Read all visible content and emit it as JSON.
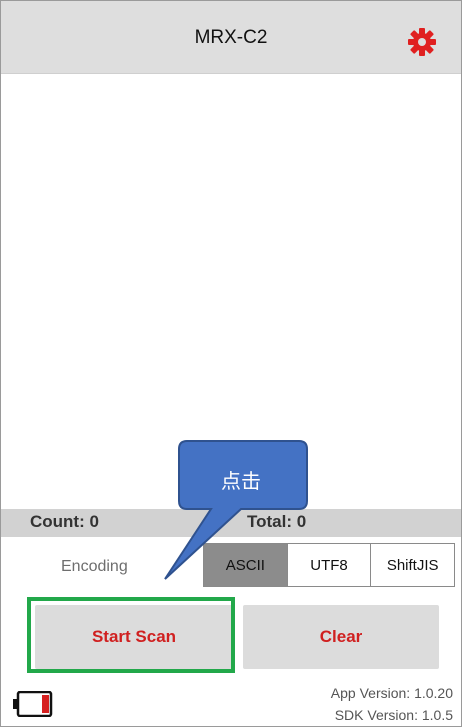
{
  "app": {
    "title": "MRX-C2"
  },
  "counts": {
    "count_label": "Count: 0",
    "total_label": "Total: 0"
  },
  "encoding": {
    "label": "Encoding",
    "options": [
      "ASCII",
      "UTF8",
      "ShiftJIS"
    ],
    "selected": "ASCII"
  },
  "buttons": {
    "start_scan": "Start Scan",
    "clear": "Clear"
  },
  "annotation": {
    "callout_text": "点击"
  },
  "footer": {
    "app_version": "App Version: 1.0.20",
    "sdk_version": "SDK Version: 1.0.5",
    "battery_icon": "battery-low-icon"
  },
  "colors": {
    "accent_red": "#d02020",
    "highlight_green": "#22a84a",
    "callout_blue": "#4472c4"
  },
  "icons": {
    "settings": "gear-icon"
  }
}
